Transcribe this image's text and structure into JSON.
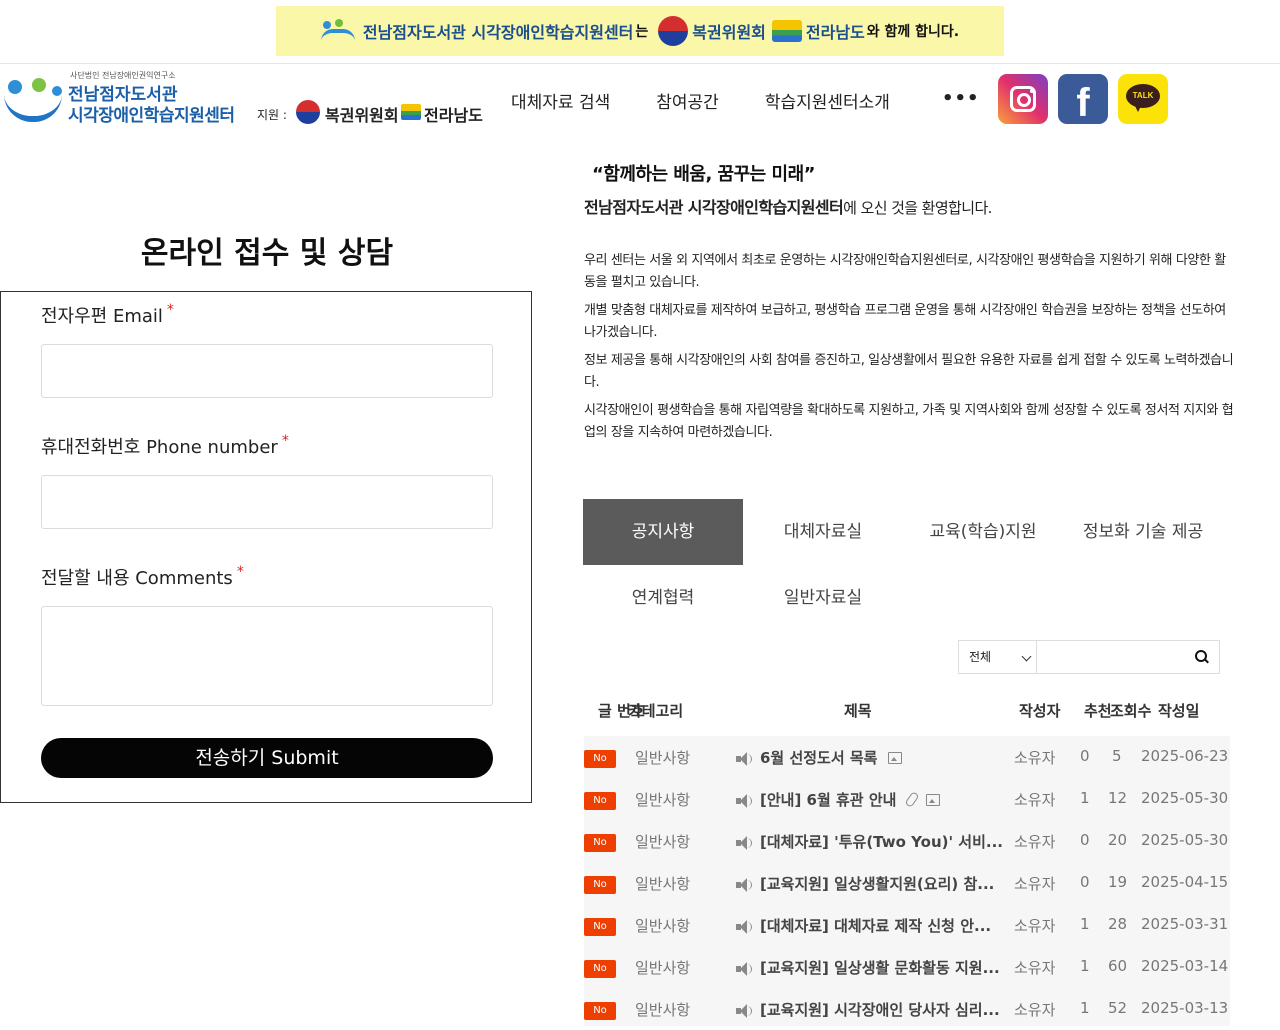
{
  "banner": {
    "org_name": "전남점자도서관 시각장애인학습지원센터",
    "particle1": "는",
    "partner1": "복권위원회",
    "partner2": "전라남도",
    "tail": "와 함께 합니다."
  },
  "logo": {
    "org_small": "사단법인 전남장애인권익연구소",
    "line1": "전남점자도서관",
    "line2": "시각장애인학습지원센터",
    "support_label": "지원 :",
    "supporter1": "복권위원회",
    "supporter2": "전라남도"
  },
  "nav": {
    "items": [
      "대체자료 검색",
      "참여공간",
      "학습지원센터소개"
    ],
    "more": "•••"
  },
  "social": {
    "facebook": "f",
    "kakao": "TALK"
  },
  "form": {
    "title": "온라인 접수 및 상담",
    "email_label": "전자우편 Email",
    "phone_label": "휴대전화번호 Phone number",
    "comments_label": "전달할 내용 Comments",
    "required_mark": "*",
    "email_value": "",
    "phone_value": "",
    "comments_value": "",
    "submit_label": "전송하기 Submit"
  },
  "intro": {
    "slogan": "“함께하는 배움, 꿈꾸는 미래”",
    "welcome_bold": "전남점자도서관 시각장애인학습지원센터",
    "welcome_rest": "에 오신 것을 환영합니다.",
    "paragraphs": [
      "우리 센터는 서울 외 지역에서 최초로 운영하는 시각장애인학습지원센터로, 시각장애인 평생학습을 지원하기 위해 다양한 활동을 펼치고 있습니다.",
      "개별 맞춤형 대체자료를 제작하여 보급하고, 평생학습 프로그램 운영을 통해 시각장애인 학습권을 보장하는 정책을 선도하여 나가겠습니다.",
      "정보 제공을 통해 시각장애인의 사회 참여를 증진하고, 일상생활에서 필요한 유용한 자료를 쉽게 접할 수 있도록 노력하겠습니다.",
      "시각장애인이 평생학습을 통해 자립역량을 확대하도록 지원하고, 가족 및 지역사회와 함께 성장할 수 있도록 정서적 지지와 협업의 장을 지속하여 마련하겠습니다."
    ]
  },
  "tabs": [
    "공지사항",
    "대체자료실",
    "교육(학습)지원",
    "정보화 기술 제공",
    "연계협력",
    "일반자료실"
  ],
  "search": {
    "category_selected": "전체",
    "query": ""
  },
  "board": {
    "headers": {
      "number": "글 번호",
      "category": "카테고리",
      "title": "제목",
      "author": "작성자",
      "likes": "추천",
      "views": "조회수",
      "date": "작성일"
    },
    "rows": [
      {
        "badge": "No",
        "category": "일반사항",
        "title": "6월 선정도서 목록",
        "author": "소유자",
        "likes": "0",
        "views": "5",
        "date": "2025-06-23",
        "has_image": true,
        "has_attach": false
      },
      {
        "badge": "No",
        "category": "일반사항",
        "title": "[안내] 6월 휴관 안내",
        "author": "소유자",
        "likes": "1",
        "views": "12",
        "date": "2025-05-30",
        "has_image": true,
        "has_attach": true
      },
      {
        "badge": "No",
        "category": "일반사항",
        "title": "[대체자료] '투유(Two You)' 서비...",
        "author": "소유자",
        "likes": "0",
        "views": "20",
        "date": "2025-05-30",
        "has_image": false,
        "has_attach": false
      },
      {
        "badge": "No",
        "category": "일반사항",
        "title": "[교육지원] 일상생활지원(요리) 참...",
        "author": "소유자",
        "likes": "0",
        "views": "19",
        "date": "2025-04-15",
        "has_image": false,
        "has_attach": false
      },
      {
        "badge": "No",
        "category": "일반사항",
        "title": "[대체자료] 대체자료 제작 신청 안...",
        "author": "소유자",
        "likes": "1",
        "views": "28",
        "date": "2025-03-31",
        "has_image": false,
        "has_attach": false
      },
      {
        "badge": "No",
        "category": "일반사항",
        "title": "[교육지원] 일상생활 문화활동 지원...",
        "author": "소유자",
        "likes": "1",
        "views": "60",
        "date": "2025-03-14",
        "has_image": false,
        "has_attach": false
      },
      {
        "badge": "No",
        "category": "일반사항",
        "title": "[교육지원] 시각장애인 당사자 심리...",
        "author": "소유자",
        "likes": "1",
        "views": "52",
        "date": "2025-03-13",
        "has_image": false,
        "has_attach": false
      }
    ]
  }
}
